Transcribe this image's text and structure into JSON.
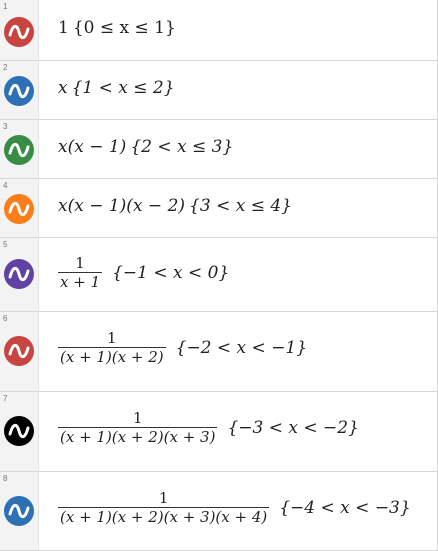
{
  "colors": {
    "red": "#c74440",
    "blue": "#2d70b3",
    "green": "#388c46",
    "orange": "#fa7e19",
    "purple": "#6042a6",
    "black": "#000000"
  },
  "expressions": [
    {
      "number": "1",
      "color": "#c74440",
      "icon": "curve-icon",
      "text": "1",
      "condition": "{0 ≤ x ≤ 1}"
    },
    {
      "number": "2",
      "color": "#2d70b3",
      "icon": "curve-icon",
      "text": "x",
      "condition": "{1 < x ≤ 2}"
    },
    {
      "number": "3",
      "color": "#388c46",
      "icon": "curve-icon",
      "text": "x(x − 1)",
      "condition": "{2 < x ≤ 3}"
    },
    {
      "number": "4",
      "color": "#fa7e19",
      "icon": "curve-icon",
      "text": "x(x − 1)(x − 2)",
      "condition": "{3 < x ≤ 4}"
    },
    {
      "number": "5",
      "color": "#6042a6",
      "icon": "curve-icon",
      "numerator": "1",
      "denominator": "x + 1",
      "condition": "{−1 < x < 0}"
    },
    {
      "number": "6",
      "color": "#c74440",
      "icon": "curve-icon",
      "numerator": "1",
      "denominator": "(x + 1)(x + 2)",
      "condition": "{−2 < x < −1}"
    },
    {
      "number": "7",
      "color": "#000000",
      "icon": "curve-icon",
      "numerator": "1",
      "denominator": "(x + 1)(x + 2)(x + 3)",
      "condition": "{−3 < x < −2}"
    },
    {
      "number": "8",
      "color": "#2d70b3",
      "icon": "curve-icon",
      "numerator": "1",
      "denominator": "(x + 1)(x + 2)(x + 3)(x + 4)",
      "condition": "{−4 < x < −3}"
    }
  ]
}
